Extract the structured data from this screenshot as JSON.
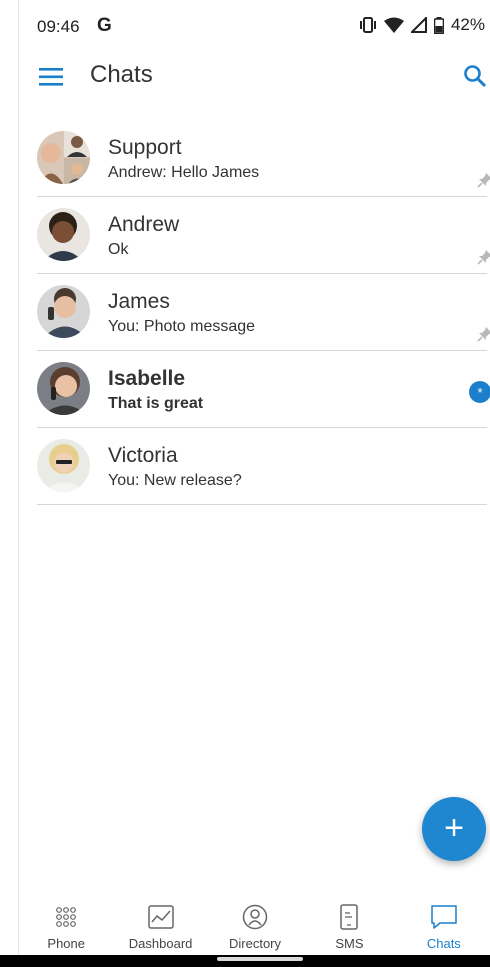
{
  "status_bar": {
    "time": "09:46",
    "carrier_icon": "G",
    "battery": "42%"
  },
  "app_bar": {
    "title": "Chats"
  },
  "chats": [
    {
      "name": "Support",
      "preview": "Andrew: Hello James",
      "pinned": true,
      "unread": false
    },
    {
      "name": "Andrew",
      "preview": "Ok",
      "pinned": true,
      "unread": false
    },
    {
      "name": "James",
      "preview": "You: Photo message",
      "pinned": true,
      "unread": false
    },
    {
      "name": "Isabelle",
      "preview": "That is great",
      "pinned": false,
      "unread": true,
      "badge": "*"
    },
    {
      "name": "Victoria",
      "preview": "You: New release?",
      "pinned": false,
      "unread": false
    }
  ],
  "fab": {
    "label": "+"
  },
  "bottom_nav": [
    {
      "label": "Phone",
      "icon": "dialpad-icon"
    },
    {
      "label": "Dashboard",
      "icon": "chart-icon"
    },
    {
      "label": "Directory",
      "icon": "contacts-icon"
    },
    {
      "label": "SMS",
      "icon": "sms-icon"
    },
    {
      "label": "Chats",
      "icon": "chat-bubble-icon",
      "active": true
    }
  ],
  "colors": {
    "accent": "#1b7fcc",
    "divider": "#d7d7d7"
  }
}
